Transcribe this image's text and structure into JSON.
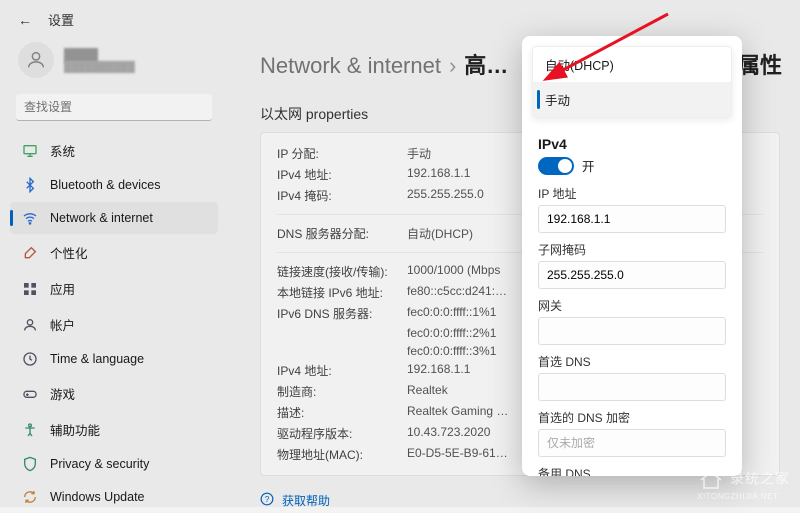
{
  "topbar": {
    "title": "设置"
  },
  "user": {
    "name": "████",
    "email": "██████████"
  },
  "search": {
    "placeholder": "查找设置"
  },
  "sidebar": {
    "items": [
      {
        "icon": "monitor",
        "label": "系统",
        "color": "#4a6"
      },
      {
        "icon": "bluetooth",
        "label": "Bluetooth & devices",
        "color": "#2a6dd8"
      },
      {
        "icon": "wifi",
        "label": "Network & internet",
        "color": "#2a6dd8",
        "active": true
      },
      {
        "icon": "brush",
        "label": "个性化",
        "color": "#c65"
      },
      {
        "icon": "apps",
        "label": "应用",
        "color": "#556"
      },
      {
        "icon": "person",
        "label": "帐户",
        "color": "#556"
      },
      {
        "icon": "clock",
        "label": "Time & language",
        "color": "#556"
      },
      {
        "icon": "gamepad",
        "label": "游戏",
        "color": "#556"
      },
      {
        "icon": "access",
        "label": "辅助功能",
        "color": "#3a8"
      },
      {
        "icon": "shield",
        "label": "Privacy & security",
        "color": "#3a7"
      },
      {
        "icon": "update",
        "label": "Windows Update",
        "color": "#c93"
      }
    ]
  },
  "breadcrumb": {
    "category": "Network & internet",
    "page": "高…",
    "suffix": "属性"
  },
  "panel": {
    "title": "以太网 properties",
    "rows1": [
      {
        "k": "IP 分配:",
        "v": "手动"
      },
      {
        "k": "IPv4 地址:",
        "v": "192.168.1.1"
      },
      {
        "k": "IPv4 掩码:",
        "v": "255.255.255.0"
      }
    ],
    "rows2": [
      {
        "k": "DNS 服务器分配:",
        "v": "自动(DHCP)"
      }
    ],
    "rows3": [
      {
        "k": "链接速度(接收/传输):",
        "v": "1000/1000 (Mbps"
      },
      {
        "k": "本地链接 IPv6 地址:",
        "v": "fe80::c5cc:d241:…"
      },
      {
        "k": "IPv6 DNS 服务器:",
        "v": "fec0:0:0:ffff::1%1\nfec0:0:0:ffff::2%1\nfec0:0:0:ffff::3%1"
      },
      {
        "k": "IPv4 地址:",
        "v": "192.168.1.1"
      },
      {
        "k": "制造商:",
        "v": "Realtek"
      },
      {
        "k": "描述:",
        "v": "Realtek Gaming …"
      },
      {
        "k": "驱动程序版本:",
        "v": "10.43.723.2020"
      },
      {
        "k": "物理地址(MAC):",
        "v": "E0-D5-5E-B9-61…"
      }
    ],
    "help": "获取帮助"
  },
  "modal": {
    "dropdown": {
      "option1": "自动(DHCP)",
      "option2": "手动"
    },
    "ipv4": {
      "title": "IPv4",
      "toggle_label": "开",
      "ip_label": "IP 地址",
      "ip_value": "192.168.1.1",
      "mask_label": "子网掩码",
      "mask_value": "255.255.255.0",
      "gateway_label": "网关",
      "gateway_value": "",
      "dns_label": "首选 DNS",
      "dns_value": "",
      "dnsenc_label": "首选的 DNS 加密",
      "dnsenc_placeholder": "仅未加密",
      "altdns_label": "备用 DNS"
    }
  },
  "watermark": {
    "text": "录统之家",
    "sub": "XITONGZHIJIA.NET"
  }
}
